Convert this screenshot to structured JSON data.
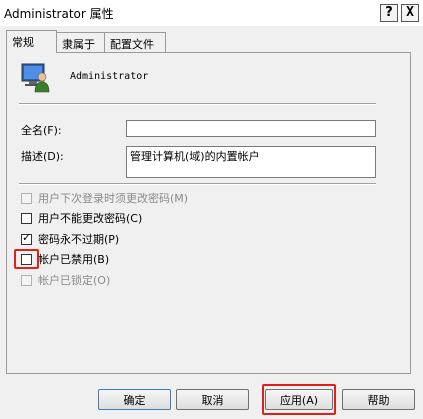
{
  "window": {
    "title": "Administrator 属性",
    "help_glyph": "?",
    "close_glyph": "X"
  },
  "tabs": [
    {
      "label": "常规",
      "active": true
    },
    {
      "label": "隶属于",
      "active": false
    },
    {
      "label": "配置文件",
      "active": false
    }
  ],
  "general": {
    "username": "Administrator",
    "fullname_label": "全名(F):",
    "fullname_value": "",
    "description_label": "描述(D):",
    "description_value": "管理计算机(域)的内置帐户"
  },
  "options": [
    {
      "label": "用户下次登录时须更改密码(M)",
      "checked": false,
      "enabled": false
    },
    {
      "label": "用户不能更改密码(C)",
      "checked": false,
      "enabled": true
    },
    {
      "label": "密码永不过期(P)",
      "checked": true,
      "enabled": true
    },
    {
      "label": "帐户已禁用(B)",
      "checked": false,
      "enabled": true
    },
    {
      "label": "帐户已锁定(O)",
      "checked": false,
      "enabled": false
    }
  ],
  "buttons": {
    "ok": "确定",
    "cancel": "取消",
    "apply": "应用(A)",
    "help": "帮助"
  },
  "colors": {
    "highlight": "#e0201a",
    "dialog_bg": "#f0f0f0"
  },
  "icons": {
    "user": "user-monitor-icon"
  }
}
